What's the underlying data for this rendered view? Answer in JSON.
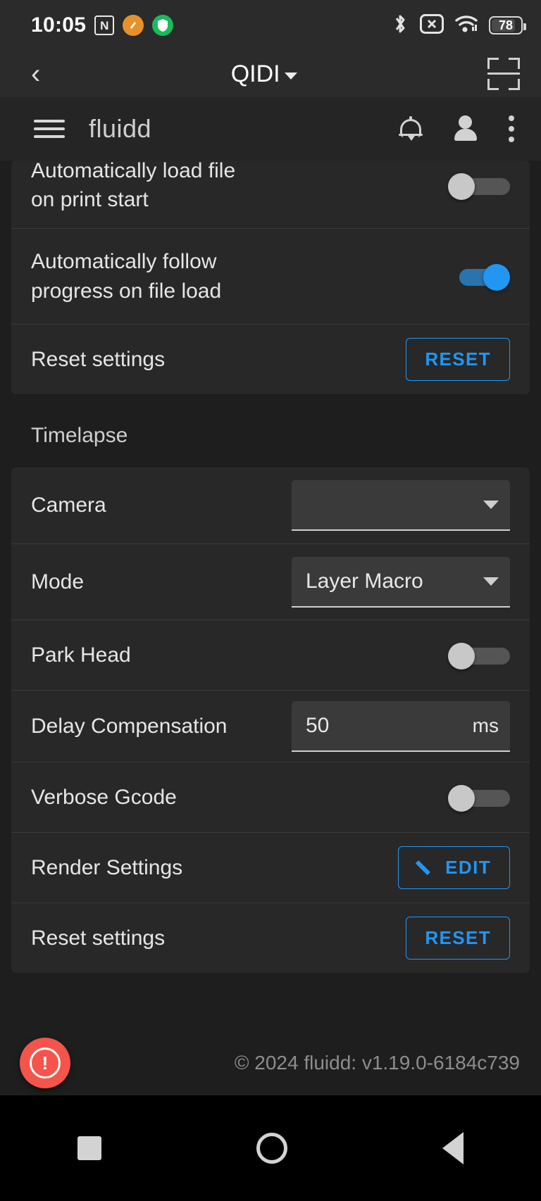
{
  "status_bar": {
    "time": "10:05",
    "nfc_glyph": "N",
    "battery_level": "78",
    "icons": [
      "nfc-icon",
      "orange-app-icon",
      "green-shield-icon",
      "bluetooth-icon",
      "no-sim-icon",
      "wifi-icon",
      "battery-icon"
    ]
  },
  "device_bar": {
    "back_label": "‹",
    "title": "QIDI"
  },
  "app_bar": {
    "brand": "fluidd",
    "icons": [
      "menu-icon",
      "bell-icon",
      "person-icon",
      "kebab-menu-icon"
    ]
  },
  "general_card": {
    "rows": [
      {
        "label": "Automatically load file\non print start",
        "control": "toggle",
        "value": "off"
      },
      {
        "label": "Automatically follow\nprogress on file load",
        "control": "toggle",
        "value": "on"
      },
      {
        "label": "Reset settings",
        "control": "button",
        "button_label": "RESET"
      }
    ]
  },
  "timelapse": {
    "section_title": "Timelapse",
    "rows": [
      {
        "label": "Camera",
        "control": "select",
        "value": ""
      },
      {
        "label": "Mode",
        "control": "select",
        "value": "Layer Macro"
      },
      {
        "label": "Park Head",
        "control": "toggle",
        "value": "off"
      },
      {
        "label": "Delay Compensation",
        "control": "input",
        "value": "50",
        "suffix": "ms"
      },
      {
        "label": "Verbose Gcode",
        "control": "toggle",
        "value": "off"
      },
      {
        "label": "Render Settings",
        "control": "button",
        "button_label": "EDIT"
      },
      {
        "label": "Reset settings",
        "control": "button",
        "button_label": "RESET"
      }
    ]
  },
  "footer": {
    "emergency_stop_glyph": "!",
    "copyright": "© 2024 fluidd: v1.19.0-6184c739"
  },
  "nav_bar": {
    "buttons": [
      "recents-button",
      "home-button",
      "back-button"
    ]
  },
  "colors": {
    "accent": "#2196f3",
    "danger": "#f4544c",
    "surface": "#282828",
    "background": "#1e1e1e"
  }
}
